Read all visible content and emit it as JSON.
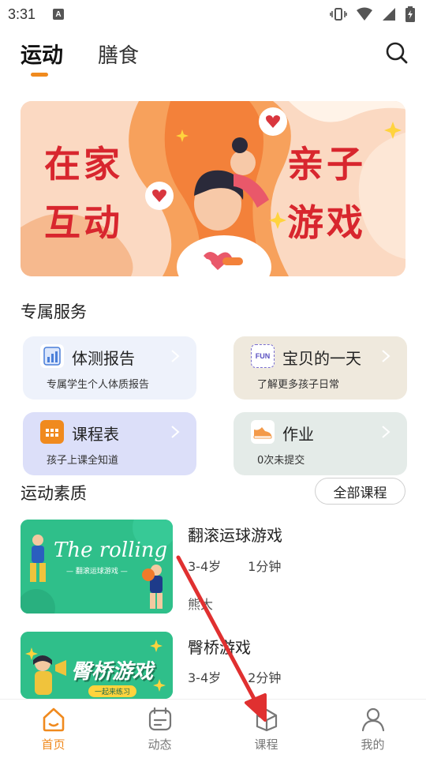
{
  "status_bar": {
    "time": "3:31",
    "notif_letter": "A"
  },
  "top_tabs": [
    {
      "label": "运动",
      "active": true
    },
    {
      "label": "膳食",
      "active": false
    }
  ],
  "banner": {
    "left_line1": "在家",
    "left_line2": "互动",
    "right_line1": "亲子",
    "right_line2": "游戏"
  },
  "services": {
    "title": "专属服务",
    "cards": [
      {
        "title": "体测报告",
        "subtitle": "专属学生个人体质报告",
        "bg": "#eef2fb",
        "icon": "report-chart-icon"
      },
      {
        "title": "宝贝的一天",
        "subtitle": "了解更多孩子日常",
        "bg": "#efe9dd",
        "icon": "fun-calendar-icon",
        "icon_text": "FUN"
      },
      {
        "title": "课程表",
        "subtitle": "孩子上课全知道",
        "bg": "#dcdff9",
        "icon": "timetable-icon"
      },
      {
        "title": "作业",
        "subtitle": "0次未提交",
        "bg": "#e4ebe8",
        "icon": "sneaker-icon"
      }
    ]
  },
  "quality": {
    "title": "运动素质",
    "all_courses_label": "全部课程",
    "courses": [
      {
        "title": "翻滚运球游戏",
        "age": "3-4岁",
        "duration": "1分钟",
        "author": "熊大",
        "thumb_title": "The rolling",
        "thumb_sub": "— 翻滚运球游戏 —"
      },
      {
        "title": "臀桥游戏",
        "age": "3-4岁",
        "duration": "2分钟",
        "thumb_title": "臀桥游戏",
        "thumb_sub": "一起来练习"
      }
    ]
  },
  "bottom_nav": [
    {
      "label": "首页",
      "icon": "home-icon",
      "active": true
    },
    {
      "label": "动态",
      "icon": "feed-icon",
      "active": false
    },
    {
      "label": "课程",
      "icon": "course-box-icon",
      "active": false
    },
    {
      "label": "我的",
      "icon": "profile-icon",
      "active": false
    }
  ],
  "colors": {
    "accent": "#f08a1e",
    "annotation_arrow": "#e03030"
  }
}
